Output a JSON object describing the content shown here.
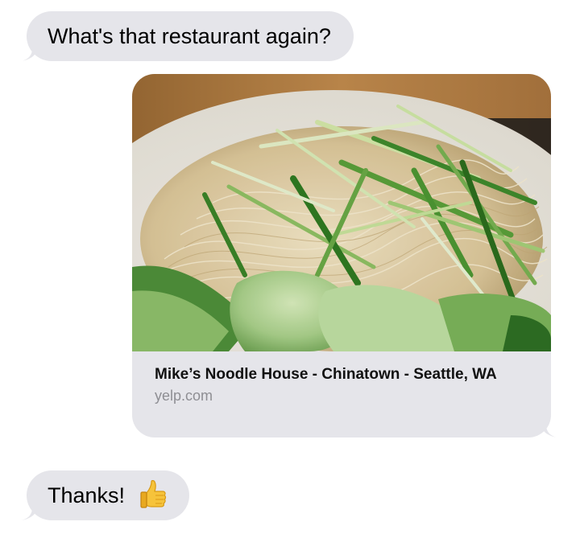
{
  "messages": [
    {
      "direction": "incoming",
      "text": "What's that restaurant again?"
    },
    {
      "direction": "outgoing",
      "type": "link_preview",
      "title": "Mike’s Noodle House - Chinatown - Seattle, WA",
      "domain": "yelp.com"
    },
    {
      "direction": "incoming",
      "text": "Thanks!",
      "emoji": "thumbs-up"
    }
  ],
  "colors": {
    "incoming_bubble": "#e5e5ea",
    "link_card": "#e5e5ea",
    "title_text": "#111111",
    "domain_text": "#8e8e93"
  }
}
